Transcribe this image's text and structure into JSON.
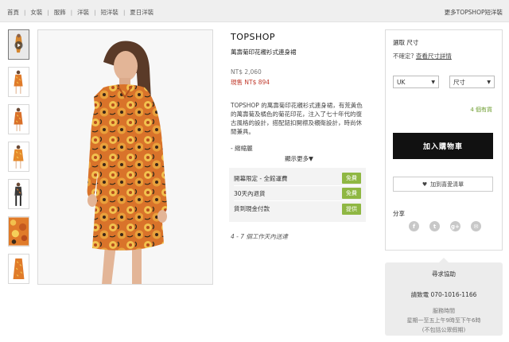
{
  "breadcrumb": {
    "items": [
      "首頁",
      "女裝",
      "服飾",
      "洋裝",
      "短洋裝",
      "夏日洋裝"
    ],
    "more_link": "更多TOPSHOP短洋裝"
  },
  "gallery": {
    "thumbnail_count": 7,
    "play_icon": "play-icon"
  },
  "product": {
    "brand": "TOPSHOP",
    "title": "萬壽菊印花襯衫式連身裙",
    "original_price": "NT$ 2,060",
    "sale_price": "現售 NT$ 894",
    "description": "TOPSHOP 的萬壽菊印花襯衫式連身裙，有荒黃色的萬壽菊及橘色的菊花印花，注入了七十年代的復古風格的設計，搭配鈕扣開襟及襯衛設計，時尚休閒兼具。",
    "bullet": "- 縐縮麗",
    "show_more": "顯示更多▼"
  },
  "perks": [
    {
      "label": "開幕限定 - 全館運費",
      "badge": "免費"
    },
    {
      "label": "30天內退貨",
      "badge": "免費"
    },
    {
      "label": "貨到現金付款",
      "badge": "提供"
    }
  ],
  "delivery_note": "4 - 7 個工作天內送達",
  "cart": {
    "size_heading": "選取 尺寸",
    "size_question": "不確定?",
    "size_guide_link": "查看尺寸詳情",
    "region_select": "UK",
    "size_select": "尺寸",
    "stock": "4 個有貨",
    "add_to_cart": "加入購物車",
    "wishlist": "加到喜愛清單",
    "share_heading": "分享",
    "social": [
      "f",
      "t",
      "g+",
      "✉"
    ]
  },
  "help": {
    "heading": "尋求協助",
    "phone": "請致電 070-1016-1166",
    "hours_heading": "服務時間",
    "hours": "星期一至五上午9時至下午6時",
    "note": "(不包括公眾假期)"
  },
  "colors": {
    "accent_green": "#8fb743",
    "sale_red": "#c0392b",
    "dress_orange": "#e07b2a",
    "dress_yellow": "#f2c14e"
  }
}
